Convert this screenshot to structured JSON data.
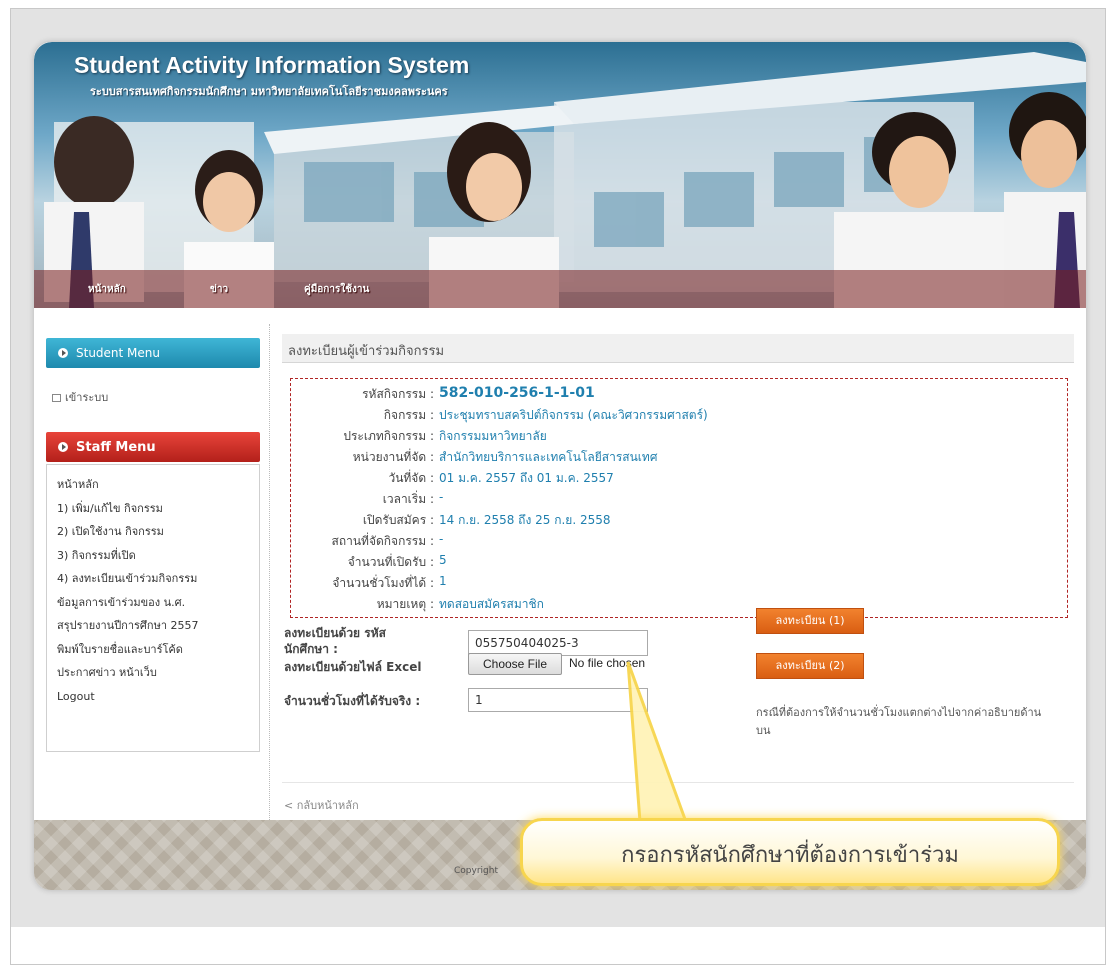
{
  "header": {
    "title": "Student Activity Information System",
    "subtitle": "ระบบสารสนเทศกิจกรรมนักศึกษา มหาวิทยาลัยเทคโนโลยีราชมงคลพระนคร",
    "nav": [
      "หน้าหลัก",
      "ข่าว",
      "คู่มือการใช้งาน"
    ]
  },
  "sidebar": {
    "student_menu_label": "Student Menu",
    "login_label": "เข้าระบบ",
    "staff_menu_label": "Staff Menu",
    "staff_items": [
      "หน้าหลัก",
      "1) เพิ่ม/แก้ไข กิจกรรม",
      "2) เปิดใช้งาน กิจกรรม",
      "3) กิจกรรมที่เปิด",
      "4) ลงทะเบียนเข้าร่วมกิจกรรม",
      "ข้อมูลการเข้าร่วมของ น.ศ.",
      "สรุปรายงานปีการศึกษา 2557",
      "พิมพ์ใบรายชื่อและบาร์โค้ด",
      "ประกาศข่าว หน้าเว็บ",
      "Logout"
    ]
  },
  "content": {
    "title": "ลงทะเบียนผู้เข้าร่วมกิจกรรม",
    "info": [
      {
        "label": "รหัสกิจกรรม :",
        "value": "582-010-256-1-1-01"
      },
      {
        "label": "กิจกรรม :",
        "value": "ประชุมทราบสคริปต์กิจกรรม (คณะวิศวกรรมศาสตร์)"
      },
      {
        "label": "ประเภทกิจกรรม :",
        "value": "กิจกรรมมหาวิทยาลัย"
      },
      {
        "label": "หน่วยงานที่จัด :",
        "value": "สำนักวิทยบริการและเทคโนโลยีสารสนเทศ"
      },
      {
        "label": "วันที่จัด :",
        "value": "01 ม.ค. 2557 ถึง 01 ม.ค. 2557"
      },
      {
        "label": "เวลาเริ่ม :",
        "value": "-"
      },
      {
        "label": "เปิดรับสมัคร :",
        "value": "14 ก.ย. 2558 ถึง 25 ก.ย. 2558"
      },
      {
        "label": "สถานที่จัดกิจกรรม :",
        "value": "-"
      },
      {
        "label": "จำนวนที่เปิดรับ :",
        "value": "5"
      },
      {
        "label": "จำนวนชั่วโมงที่ได้ :",
        "value": "1"
      },
      {
        "label": "หมายเหตุ :",
        "value": "ทดสอบสมัครสมาชิก"
      }
    ],
    "form": {
      "student_id_label_line1": "ลงทะเบียนด้วย รหัส",
      "student_id_label_line2": "นักศึกษา :",
      "student_id_value": "055750404025-3",
      "excel_label": "ลงทะเบียนด้วยไฟล์ Excel",
      "choose_file_label": "Choose File",
      "no_file_label": "No file chosen",
      "hours_label": "จำนวนชั่วโมงที่ได้รับจริง :",
      "hours_value": "1",
      "register_btn_1": "ลงทะเบียน (1)",
      "register_btn_2": "ลงทะเบียน (2)",
      "note": "กรณีที่ต้องการให้จำนวนชั่วโมงแตกต่างไปจากค่าอธิบายด้านบน"
    },
    "back_link": "< กลับหน้าหลัก"
  },
  "footer": {
    "copyright": "Copyright"
  },
  "callout": {
    "text": "กรอกรหัสนักศึกษาที่ต้องการเข้าร่วม"
  }
}
